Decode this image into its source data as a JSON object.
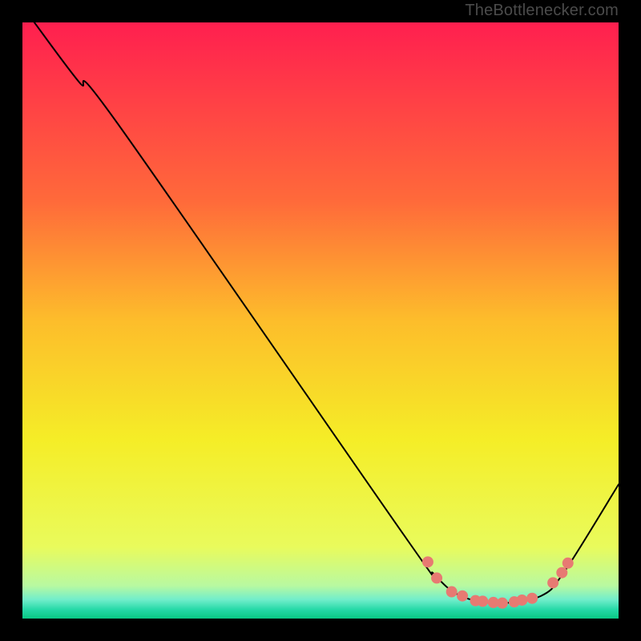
{
  "watermark": "TheBottlenecker.com",
  "brand_url_text": "TheBottlenecker.com",
  "chart_data": {
    "type": "line",
    "title": "",
    "xlabel": "",
    "ylabel": "",
    "xlim": [
      0,
      1
    ],
    "ylim": [
      0,
      1
    ],
    "legend": false,
    "grid": false,
    "background_gradient": {
      "stops": [
        {
          "pos": 0.0,
          "color": "#ff1f4f"
        },
        {
          "pos": 0.3,
          "color": "#ff6a3a"
        },
        {
          "pos": 0.5,
          "color": "#fdbd2b"
        },
        {
          "pos": 0.7,
          "color": "#f5ed27"
        },
        {
          "pos": 0.88,
          "color": "#e9fb5c"
        },
        {
          "pos": 0.945,
          "color": "#b8f9a1"
        },
        {
          "pos": 0.968,
          "color": "#72eecb"
        },
        {
          "pos": 0.985,
          "color": "#25d9a7"
        },
        {
          "pos": 1.0,
          "color": "#09c884"
        }
      ]
    },
    "series": [
      {
        "name": "bottleneck-curve",
        "type": "line",
        "color": "#000000",
        "width": 2,
        "points": [
          {
            "x": 0.02,
            "y": 1.0
          },
          {
            "x": 0.095,
            "y": 0.9
          },
          {
            "x": 0.16,
            "y": 0.83
          },
          {
            "x": 0.64,
            "y": 0.14
          },
          {
            "x": 0.69,
            "y": 0.075
          },
          {
            "x": 0.735,
            "y": 0.038
          },
          {
            "x": 0.8,
            "y": 0.026
          },
          {
            "x": 0.87,
            "y": 0.038
          },
          {
            "x": 0.91,
            "y": 0.08
          },
          {
            "x": 1.0,
            "y": 0.225
          }
        ]
      },
      {
        "name": "marker-dots",
        "type": "scatter",
        "color": "#e77a72",
        "radius": 7,
        "points": [
          {
            "x": 0.68,
            "y": 0.095
          },
          {
            "x": 0.695,
            "y": 0.068
          },
          {
            "x": 0.72,
            "y": 0.045
          },
          {
            "x": 0.738,
            "y": 0.038
          },
          {
            "x": 0.76,
            "y": 0.03
          },
          {
            "x": 0.772,
            "y": 0.029
          },
          {
            "x": 0.79,
            "y": 0.027
          },
          {
            "x": 0.805,
            "y": 0.026
          },
          {
            "x": 0.825,
            "y": 0.028
          },
          {
            "x": 0.838,
            "y": 0.031
          },
          {
            "x": 0.855,
            "y": 0.034
          },
          {
            "x": 0.89,
            "y": 0.06
          },
          {
            "x": 0.905,
            "y": 0.077
          },
          {
            "x": 0.915,
            "y": 0.093
          }
        ]
      }
    ]
  }
}
